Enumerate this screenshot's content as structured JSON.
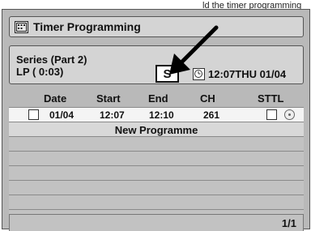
{
  "top_caption": "ld the timer programming",
  "header": {
    "title": "Timer Programming"
  },
  "info": {
    "programme_name": "Series (Part 2)",
    "mode": "LP   ( 0:03)",
    "series_badge": "S",
    "clock": "12:07THU 01/04"
  },
  "columns": {
    "date": "Date",
    "start": "Start",
    "end": "End",
    "ch": "CH",
    "sttl": "STTL"
  },
  "entries": [
    {
      "date": "01/04",
      "start": "12:07",
      "end": "12:10",
      "ch": "261",
      "checked": false
    }
  ],
  "new_programme_label": "New Programme",
  "empty_rows": 6,
  "page_indicator": "1/1",
  "icons": [
    "timer-icon",
    "clock-icon",
    "disc-icon",
    "pointer-arrow-icon"
  ],
  "colors": {
    "background": "#b9b9b9",
    "selected_row": "#f4f4f4",
    "text": "#111111"
  }
}
